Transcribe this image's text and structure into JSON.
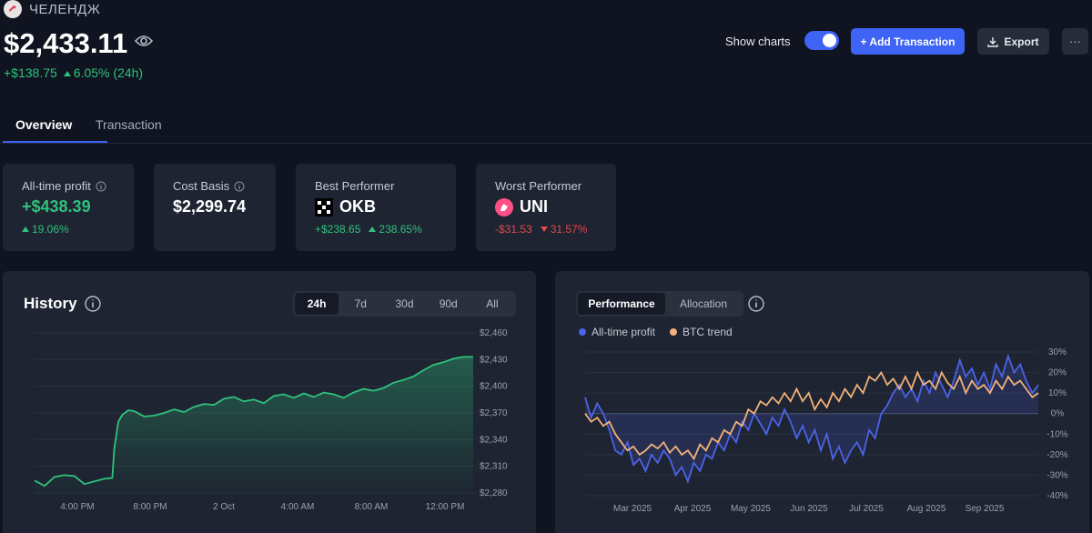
{
  "header": {
    "portfolio_name": "ЧЕЛЕНДЖ",
    "balance": "$2,433.11",
    "change_amount": "+$138.75",
    "change_percent": "6.05% (24h)",
    "show_charts_label": "Show charts",
    "show_charts_on": true,
    "add_transaction_label": "+ Add Transaction",
    "export_label": "Export",
    "more_label": "···"
  },
  "tabs": [
    {
      "label": "Overview",
      "active": true
    },
    {
      "label": "Transaction",
      "active": false
    }
  ],
  "cards": {
    "all_time_profit": {
      "title": "All-time profit",
      "value": "+$438.39",
      "percent": "19.06%"
    },
    "cost_basis": {
      "title": "Cost Basis",
      "value": "$2,299.74"
    },
    "best_performer": {
      "title": "Best Performer",
      "coin": "OKB",
      "amount": "+$238.65",
      "percent": "238.65%"
    },
    "worst_performer": {
      "title": "Worst Performer",
      "coin": "UNI",
      "amount": "-$31.53",
      "percent": "31.57%"
    }
  },
  "history": {
    "title": "History",
    "ranges": [
      {
        "label": "24h",
        "active": true
      },
      {
        "label": "7d",
        "active": false
      },
      {
        "label": "30d",
        "active": false
      },
      {
        "label": "90d",
        "active": false
      },
      {
        "label": "All",
        "active": false
      }
    ]
  },
  "performance": {
    "tabs": [
      {
        "label": "Performance",
        "active": true
      },
      {
        "label": "Allocation",
        "active": false
      }
    ],
    "legend": [
      {
        "label": "All-time profit",
        "color": "#4b63e8"
      },
      {
        "label": "BTC trend",
        "color": "#f2b27a"
      }
    ]
  },
  "colors": {
    "accent": "#3e63f5",
    "positive": "#2fc27c",
    "negative": "#e5484d"
  },
  "chart_data": [
    {
      "type": "area",
      "title": "History",
      "x_ticks": [
        "4:00 PM",
        "8:00 PM",
        "2 Oct",
        "4:00 AM",
        "8:00 AM",
        "12:00 PM"
      ],
      "y_ticks": [
        "$2,460",
        "$2,430",
        "$2,400",
        "$2,370",
        "$2,340",
        "$2,310",
        "$2,280"
      ],
      "ylim": [
        2280,
        2460
      ],
      "grid": true,
      "series": [
        {
          "color": "#2fc27c",
          "x": [
            0,
            0.5,
            1,
            1.5,
            2,
            2.5,
            3,
            3.5,
            3.9,
            4.0,
            4.2,
            4.4,
            4.7,
            5,
            5.5,
            6,
            6.5,
            7,
            7.5,
            8,
            8.5,
            9,
            9.5,
            10,
            10.5,
            11,
            11.5,
            12,
            12.5,
            13,
            13.5,
            14,
            14.5,
            15,
            15.5,
            16,
            16.5,
            17,
            17.5,
            18,
            18.5,
            19,
            19.5,
            20,
            20.5,
            21,
            21.5,
            22
          ],
          "values": [
            2294,
            2288,
            2298,
            2300,
            2299,
            2290,
            2293,
            2296,
            2297,
            2330,
            2360,
            2368,
            2373,
            2372,
            2366,
            2367,
            2370,
            2374,
            2371,
            2377,
            2380,
            2379,
            2386,
            2388,
            2383,
            2385,
            2381,
            2389,
            2391,
            2387,
            2392,
            2388,
            2393,
            2391,
            2387,
            2393,
            2397,
            2395,
            2398,
            2404,
            2407,
            2411,
            2418,
            2424,
            2427,
            2431,
            2433,
            2433
          ]
        }
      ]
    },
    {
      "type": "line",
      "title": "",
      "x_ticks": [
        "Mar 2025",
        "Apr 2025",
        "May 2025",
        "Jun 2025",
        "Jul 2025",
        "Aug 2025",
        "Sep 2025"
      ],
      "y_ticks": [
        "30%",
        "20%",
        "10%",
        "0%",
        "-10%",
        "-20%",
        "-30%",
        "-40%"
      ],
      "ylim": [
        -40,
        30
      ],
      "grid": true,
      "legend": "top-left",
      "series": [
        {
          "name": "All-time profit",
          "color": "#4b63e8",
          "x": [
            0,
            3,
            6,
            9,
            12,
            15,
            18,
            21,
            24,
            27,
            30,
            33,
            36,
            39,
            42,
            45,
            48,
            51,
            54,
            57,
            60,
            63,
            66,
            69,
            72,
            75,
            78,
            81,
            84,
            87,
            90,
            93,
            96,
            99,
            102,
            105,
            108,
            111,
            114,
            117,
            120,
            123,
            126,
            129,
            132,
            135,
            138,
            141,
            144,
            147,
            150,
            153,
            156,
            159,
            162,
            165,
            168,
            171,
            174,
            177,
            180,
            183,
            186,
            189,
            192,
            195,
            198,
            201,
            204,
            207,
            210,
            213,
            216,
            219,
            222,
            225
          ],
          "values": [
            8,
            -2,
            5,
            0,
            -8,
            -18,
            -20,
            -14,
            -25,
            -22,
            -28,
            -20,
            -24,
            -18,
            -22,
            -30,
            -26,
            -33,
            -24,
            -28,
            -20,
            -22,
            -14,
            -18,
            -10,
            -14,
            -4,
            -8,
            0,
            -5,
            -10,
            -2,
            -6,
            2,
            -4,
            -12,
            -6,
            -14,
            -8,
            -18,
            -10,
            -22,
            -16,
            -24,
            -18,
            -14,
            -20,
            -8,
            -12,
            0,
            4,
            10,
            14,
            8,
            12,
            6,
            16,
            10,
            20,
            14,
            8,
            16,
            26,
            18,
            22,
            14,
            20,
            12,
            24,
            18,
            28,
            20,
            24,
            16,
            10,
            14
          ]
        },
        {
          "name": "BTC trend",
          "color": "#f2b27a",
          "x": [
            0,
            3,
            6,
            9,
            12,
            15,
            18,
            21,
            24,
            27,
            30,
            33,
            36,
            39,
            42,
            45,
            48,
            51,
            54,
            57,
            60,
            63,
            66,
            69,
            72,
            75,
            78,
            81,
            84,
            87,
            90,
            93,
            96,
            99,
            102,
            105,
            108,
            111,
            114,
            117,
            120,
            123,
            126,
            129,
            132,
            135,
            138,
            141,
            144,
            147,
            150,
            153,
            156,
            159,
            162,
            165,
            168,
            171,
            174,
            177,
            180,
            183,
            186,
            189,
            192,
            195,
            198,
            201,
            204,
            207,
            210,
            213,
            216,
            219,
            222,
            225
          ],
          "values": [
            0,
            -4,
            -2,
            -6,
            -4,
            -10,
            -14,
            -18,
            -16,
            -20,
            -18,
            -15,
            -17,
            -14,
            -19,
            -16,
            -20,
            -18,
            -22,
            -15,
            -18,
            -12,
            -14,
            -8,
            -10,
            -4,
            -6,
            2,
            0,
            6,
            4,
            8,
            5,
            10,
            6,
            12,
            6,
            10,
            2,
            7,
            3,
            10,
            6,
            12,
            8,
            14,
            10,
            18,
            16,
            20,
            14,
            17,
            12,
            18,
            12,
            20,
            14,
            16,
            12,
            20,
            15,
            12,
            18,
            10,
            16,
            12,
            14,
            10,
            16,
            12,
            18,
            14,
            16,
            12,
            8,
            10
          ]
        }
      ]
    }
  ]
}
